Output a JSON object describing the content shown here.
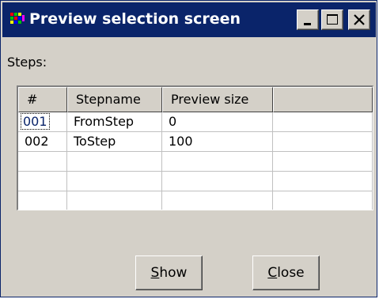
{
  "window": {
    "title": "Preview selection screen",
    "icon": "app-grid-icon"
  },
  "caption_buttons": {
    "minimize": "minimize-icon",
    "maximize": "maximize-icon",
    "close": "close-icon"
  },
  "steps_label": "Steps:",
  "table": {
    "headers": [
      "#",
      "Stepname",
      "Preview size",
      ""
    ],
    "rows": [
      [
        "001",
        "FromStep",
        "0",
        ""
      ],
      [
        "002",
        "ToStep",
        "100",
        ""
      ],
      [
        "",
        "",
        "",
        ""
      ],
      [
        "",
        "",
        "",
        ""
      ],
      [
        "",
        "",
        "",
        ""
      ]
    ]
  },
  "buttons": {
    "show": {
      "mnemonic": "S",
      "rest": "how"
    },
    "close": {
      "mnemonic": "C",
      "rest": "lose"
    }
  },
  "colors": {
    "titlebar": "#0a246a",
    "face": "#d4d0c8",
    "selected_text": "#0a246a"
  }
}
